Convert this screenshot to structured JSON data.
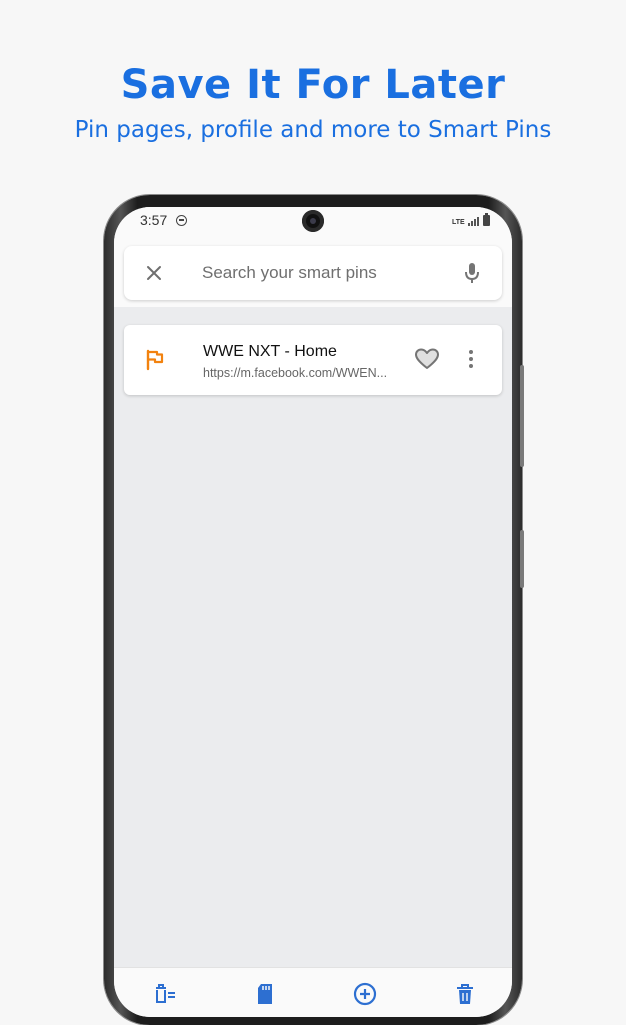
{
  "promo": {
    "headline": "Save It For Later",
    "subheadline": "Pin pages, profile and more to Smart Pins"
  },
  "status_bar": {
    "time": "3:57",
    "network_label": "LTE",
    "icons": [
      "do-not-disturb-icon",
      "lte-icon",
      "signal-icon",
      "battery-icon"
    ]
  },
  "search": {
    "placeholder": "Search your smart pins",
    "value": "",
    "icons": [
      "close-icon",
      "mic-icon"
    ]
  },
  "pins": [
    {
      "title": "WWE NXT - Home",
      "url": "https://m.facebook.com/WWEN...",
      "icon": "flag-icon",
      "favorited": false
    }
  ],
  "bottom_nav": {
    "icons": [
      "delete-list-icon",
      "sd-card-icon",
      "add-circle-icon",
      "trash-icon"
    ]
  },
  "colors": {
    "accent": "#1a6fe0",
    "flag": "#f2820f",
    "screen_background": "#ebecee",
    "icon_gray": "#757575",
    "nav_icon": "#2d6fd1"
  }
}
